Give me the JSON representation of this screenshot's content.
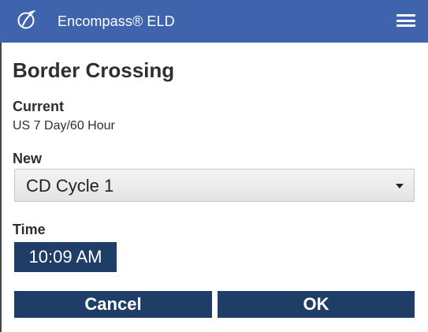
{
  "app": {
    "title": "Encompass® ELD",
    "logo_icon": "encompass-logo-icon",
    "menu_icon": "hamburger-menu-icon",
    "header_color": "#3f63ad"
  },
  "page": {
    "title": "Border Crossing"
  },
  "current": {
    "label": "Current",
    "value": "US 7 Day/60 Hour"
  },
  "new": {
    "label": "New",
    "selected": "CD Cycle 1",
    "caret_icon": "caret-down-icon"
  },
  "time": {
    "label": "Time",
    "value": "10:09 AM"
  },
  "actions": {
    "cancel_label": "Cancel",
    "ok_label": "OK",
    "button_color": "#1f3e67"
  }
}
